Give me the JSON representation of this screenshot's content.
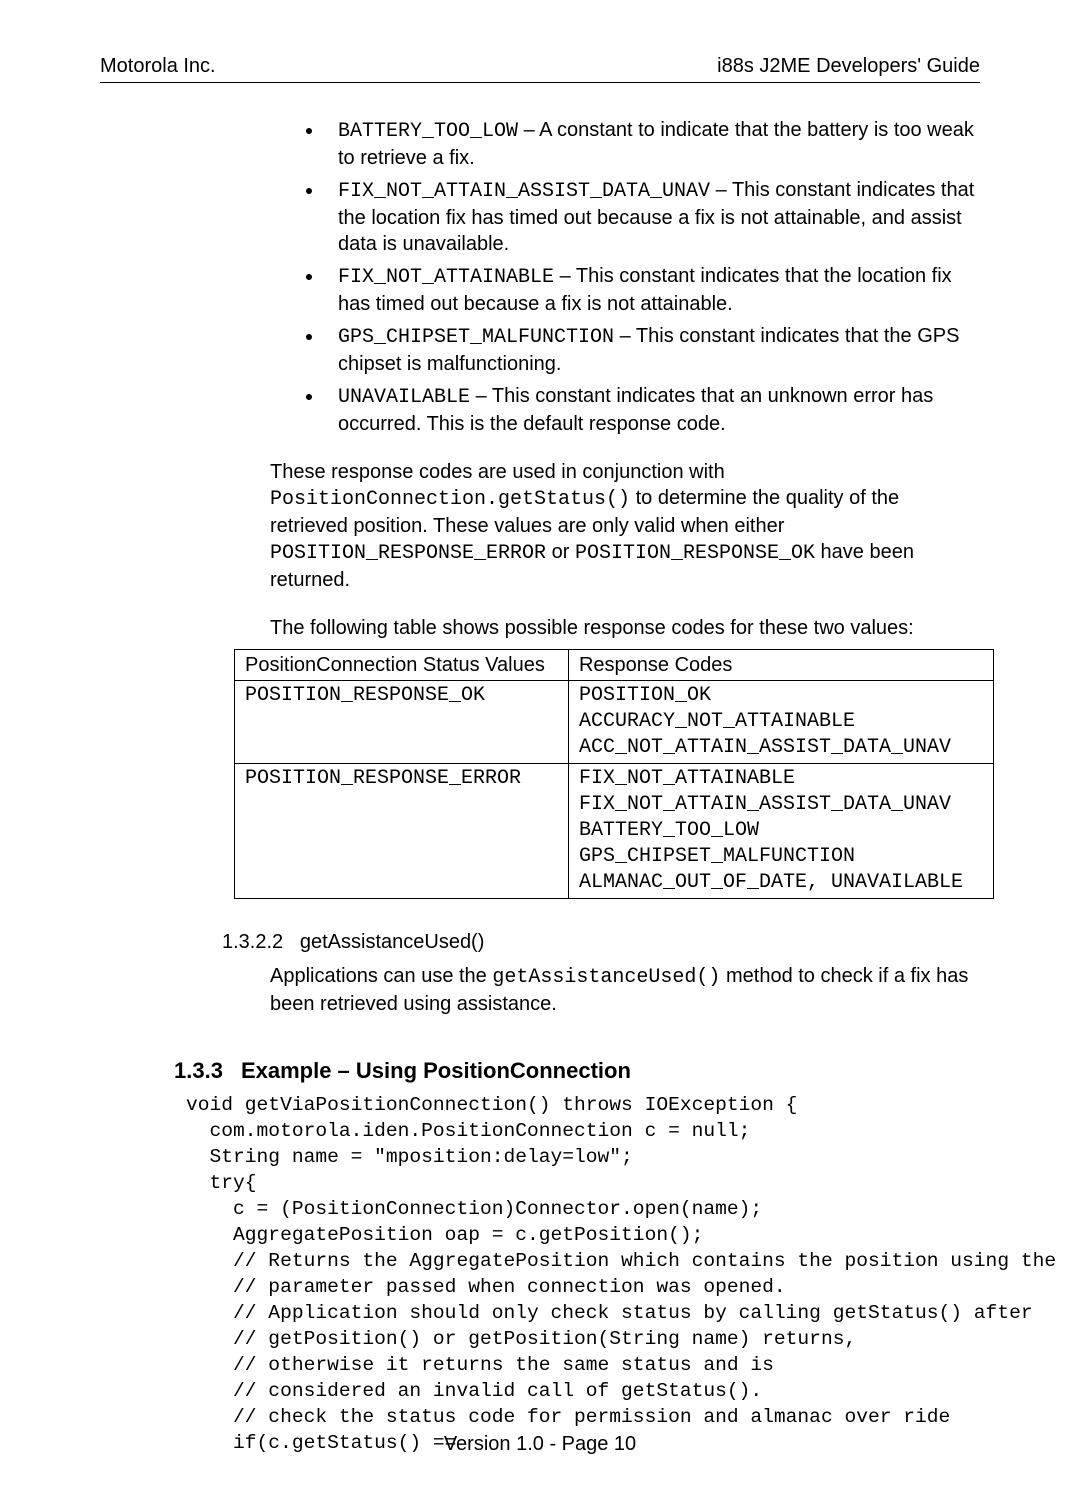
{
  "header": {
    "left": "Motorola Inc.",
    "right": "i88s J2ME Developers' Guide"
  },
  "consts": {
    "battery": {
      "name": "BATTERY_TOO_LOW",
      "desc": " – A constant to indicate that the battery is too weak to retrieve a fix."
    },
    "fixna_assist": {
      "name": "FIX_NOT_ATTAIN_ASSIST_DATA_UNAV",
      "desc": " – This constant indicates that the location fix has timed out because a fix is not attainable, and assist data is unavailable."
    },
    "fixna": {
      "name": "FIX_NOT_ATTAINABLE",
      "desc": " – This constant indicates that the location fix has timed out because a fix is not attainable."
    },
    "gps": {
      "name": "GPS_CHIPSET_MALFUNCTION",
      "desc": " – This constant indicates that the GPS chipset is malfunctioning."
    },
    "unavail": {
      "name": "UNAVAILABLE",
      "desc": " – This constant indicates that an unknown error has occurred. This is the default response code."
    }
  },
  "para1": {
    "a": "These response codes are used in conjunction with ",
    "code1": "PositionConnection.getStatus()",
    "b": " to determine the quality of the retrieved position. These values are only valid when either ",
    "code2": "POSITION_RESPONSE_ERROR",
    "c": " or ",
    "code3": "POSITION_RESPONSE_OK",
    "d": " have been returned."
  },
  "para2": "The following table shows possible response codes for these two values:",
  "table": {
    "h1": "PositionConnection Status Values",
    "h2": "Response Codes",
    "r1c1": "POSITION_RESPONSE_OK",
    "r1c2": "POSITION_OK\nACCURACY_NOT_ATTAINABLE\nACC_NOT_ATTAIN_ASSIST_DATA_UNAV",
    "r2c1": "POSITION_RESPONSE_ERROR",
    "r2c2": "FIX_NOT_ATTAINABLE\nFIX_NOT_ATTAIN_ASSIST_DATA_UNAV\nBATTERY_TOO_LOW\nGPS_CHIPSET_MALFUNCTION\nALMANAC_OUT_OF_DATE, UNAVAILABLE"
  },
  "sec1322": {
    "num": "1.3.2.2",
    "title": "getAssistanceUsed()",
    "p_a": "Applications can use the ",
    "p_code": "getAssistanceUsed()",
    "p_b": " method to check if a fix has been retrieved using assistance."
  },
  "sec133": {
    "num": "1.3.3",
    "title": "Example – Using PositionConnection"
  },
  "code_example": "void getViaPositionConnection() throws IOException {\n  com.motorola.iden.PositionConnection c = null;\n  String name = \"mposition:delay=low\";\n  try{\n    c = (PositionConnection)Connector.open(name);\n    AggregatePosition oap = c.getPosition();\n    // Returns the AggregatePosition which contains the position using the\n    // parameter passed when connection was opened.\n    // Application should only check status by calling getStatus() after\n    // getPosition() or getPosition(String name) returns,\n    // otherwise it returns the same status and is\n    // considered an invalid call of getStatus().\n    // check the status code for permission and almanac over ride\n    if(c.getStatus() ==",
  "footer": "Version 1.0 - Page 10"
}
